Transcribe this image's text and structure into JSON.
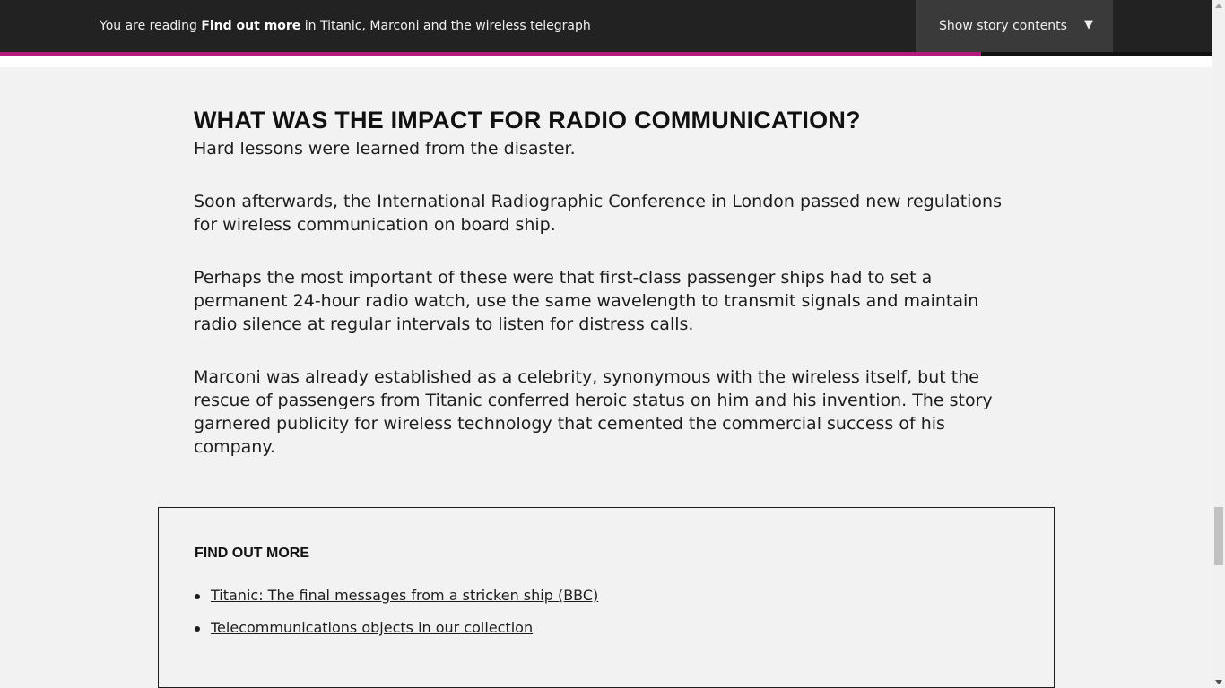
{
  "header": {
    "reading_prefix": "You are reading ",
    "current_section": "Find out more",
    "reading_middle": " in ",
    "story_title": "Titanic, Marconi and the wireless telegraph",
    "contents_button_label": "Show story contents",
    "contents_button_icon": "chevron-down-icon",
    "progress_fraction": 0.81,
    "accent_color": "#b4197e"
  },
  "article": {
    "heading": "WHAT WAS THE IMPACT FOR RADIO COMMUNICATION?",
    "paragraphs": [
      "Hard lessons were learned from the disaster.",
      "Soon afterwards, the International Radiographic Conference in London passed new regulations for wireless communication on board ship.",
      "Perhaps the most important of these were that first-class passenger ships had to set a permanent 24-hour radio watch, use the same wavelength to transmit signals and maintain radio silence at regular intervals to listen for distress calls.",
      "Marconi was already established as a celebrity, synonymous with the wireless itself, but the rescue of passengers from Titanic conferred heroic status on him and his invention. The story garnered publicity for wireless technology that cemented the commercial success of his company."
    ]
  },
  "find_out_more": {
    "title": "FIND OUT MORE",
    "links": [
      "Titanic: The final messages from a stricken ship (BBC)",
      "Telecommunications objects in our collection"
    ]
  }
}
